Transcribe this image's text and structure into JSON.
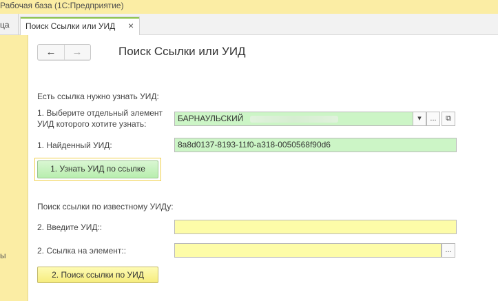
{
  "window": {
    "title": "Рабочая база  (1С:Предприятие)"
  },
  "tabs": {
    "left_fragment": "ца",
    "active": {
      "label": "Поиск Ссылки или УИД",
      "close": "×"
    }
  },
  "sidebar": {
    "fragment": "ы"
  },
  "nav": {
    "back": "←",
    "forward": "→"
  },
  "page_title": "Поиск Ссылки или УИД",
  "section1": {
    "heading": "Есть ссылка нужно узнать УИД:",
    "select_label_line1": "1. Выберите отдельный элемент",
    "select_label_line2": "УИД которого хотите узнать:",
    "select_value": "БАРНАУЛЬСКИЙ",
    "dropdown_glyph": "▾",
    "ellipsis_glyph": "...",
    "open_glyph": "⧉",
    "found_label": "1. Найденный УИД:",
    "found_value": "8a8d0137-8193-11f0-a318-0050568f90d6",
    "button": "1. Узнать УИД по ссылке"
  },
  "section2": {
    "heading": "Поиск ссылки по известному УИДу:",
    "uid_label": "2. Введите УИД::",
    "uid_value": "",
    "link_label": "2. Ссылка на элемент::",
    "link_value": "",
    "ellipsis_glyph": "...",
    "button": "2. Поиск ссылки по УИД"
  },
  "colors": {
    "title_bar": "#fbeda4",
    "green_field": "#ccf5c6",
    "yellow_field": "#fdfca8",
    "tab_accent": "#8bc34a"
  }
}
